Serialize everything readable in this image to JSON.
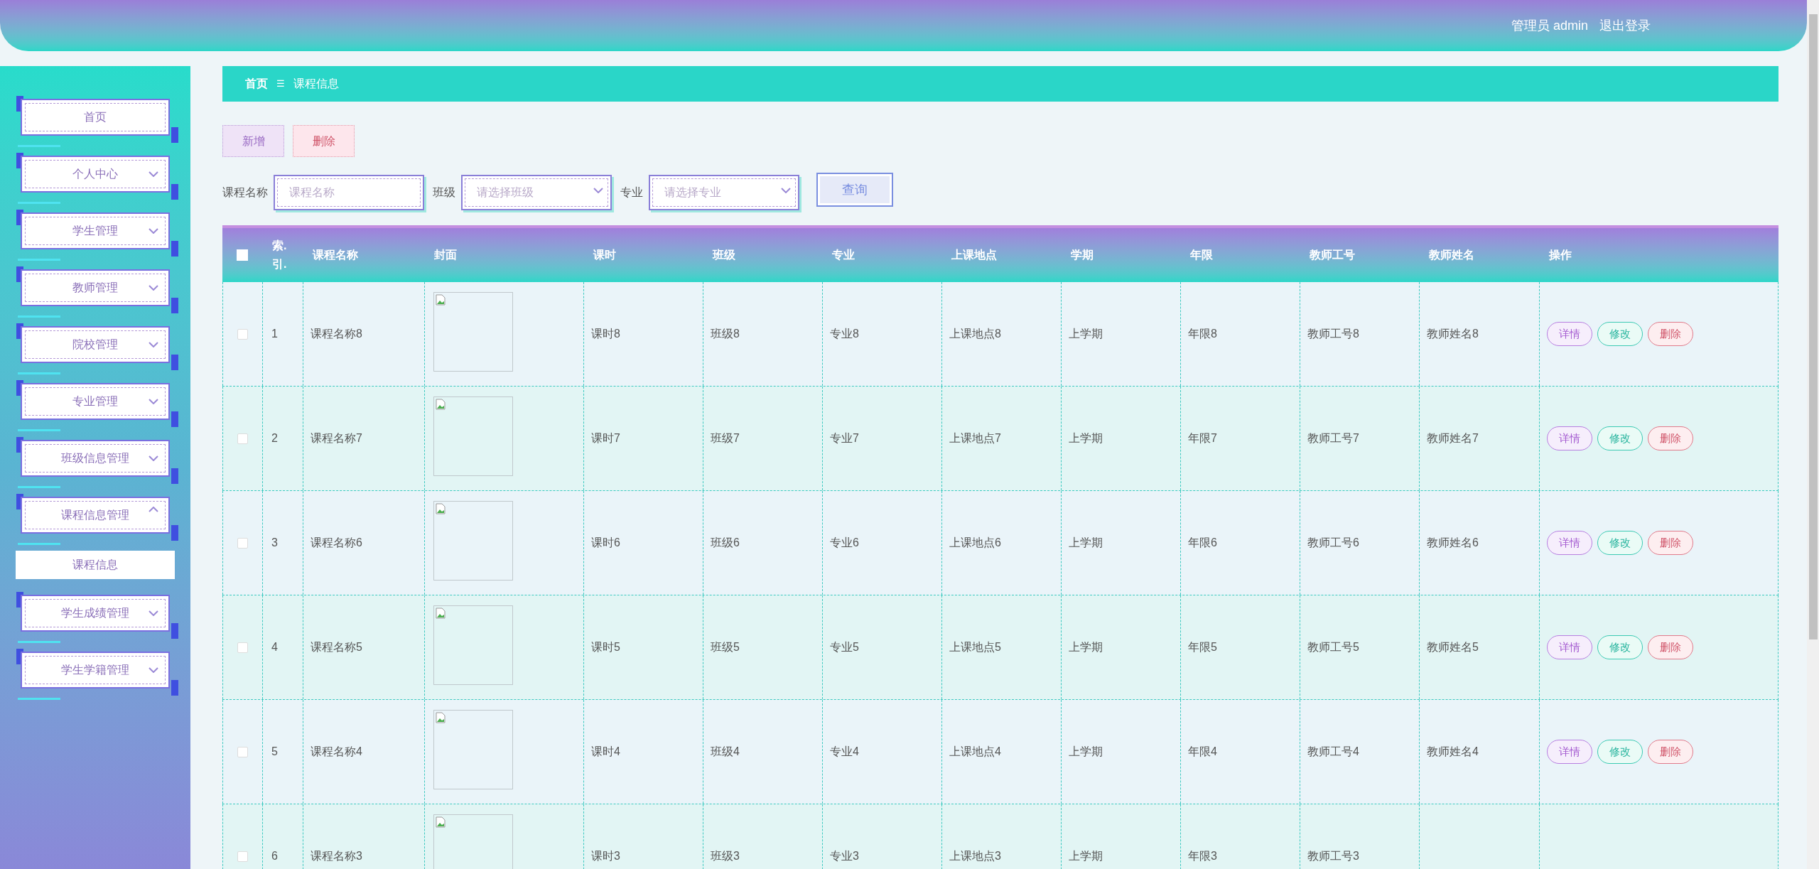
{
  "header": {
    "user": "管理员 admin",
    "logout": "退出登录"
  },
  "sidebar": {
    "items": [
      {
        "label": "首页",
        "kind": "link"
      },
      {
        "label": "个人中心",
        "kind": "group",
        "expanded": false
      },
      {
        "label": "学生管理",
        "kind": "group",
        "expanded": false
      },
      {
        "label": "教师管理",
        "kind": "group",
        "expanded": false
      },
      {
        "label": "院校管理",
        "kind": "group",
        "expanded": false
      },
      {
        "label": "专业管理",
        "kind": "group",
        "expanded": false
      },
      {
        "label": "班级信息管理",
        "kind": "group",
        "expanded": false
      },
      {
        "label": "课程信息管理",
        "kind": "group",
        "expanded": true,
        "children": [
          {
            "label": "课程信息"
          }
        ]
      },
      {
        "label": "学生成绩管理",
        "kind": "group",
        "expanded": false
      },
      {
        "label": "学生学籍管理",
        "kind": "group",
        "expanded": false
      }
    ]
  },
  "breadcrumb": {
    "home": "首页",
    "separator": "☰",
    "current": "课程信息"
  },
  "toolbar": {
    "buttons": [
      {
        "label": "新增",
        "kind": "add"
      },
      {
        "label": "删除",
        "kind": "delete"
      }
    ]
  },
  "filters": [
    {
      "label": "课程名称",
      "kind": "input",
      "placeholder": "课程名称"
    },
    {
      "label": "班级",
      "kind": "select",
      "placeholder": "请选择班级"
    },
    {
      "label": "专业",
      "kind": "select",
      "placeholder": "请选择专业"
    }
  ],
  "search_button": "查询",
  "table": {
    "columns": [
      "索.引.",
      "课程名称",
      "封面",
      "课时",
      "班级",
      "专业",
      "上课地点",
      "学期",
      "年限",
      "教师工号",
      "教师姓名",
      "操作"
    ],
    "select_all_checked": false,
    "rows": [
      {
        "checked": false,
        "cells": [
          "1",
          "课程名称8",
          "",
          "课时8",
          "班级8",
          "专业8",
          "上课地点8",
          "上学期",
          "年限8",
          "教师工号8",
          "教师姓名8"
        ],
        "actions": [
          {
            "label": "详情",
            "kind": "detail"
          },
          {
            "label": "修改",
            "kind": "edit"
          },
          {
            "label": "删除",
            "kind": "delete"
          }
        ]
      },
      {
        "checked": false,
        "cells": [
          "2",
          "课程名称7",
          "",
          "课时7",
          "班级7",
          "专业7",
          "上课地点7",
          "上学期",
          "年限7",
          "教师工号7",
          "教师姓名7"
        ],
        "actions": [
          {
            "label": "详情",
            "kind": "detail"
          },
          {
            "label": "修改",
            "kind": "edit"
          },
          {
            "label": "删除",
            "kind": "delete"
          }
        ]
      },
      {
        "checked": false,
        "cells": [
          "3",
          "课程名称6",
          "",
          "课时6",
          "班级6",
          "专业6",
          "上课地点6",
          "上学期",
          "年限6",
          "教师工号6",
          "教师姓名6"
        ],
        "actions": [
          {
            "label": "详情",
            "kind": "detail"
          },
          {
            "label": "修改",
            "kind": "edit"
          },
          {
            "label": "删除",
            "kind": "delete"
          }
        ]
      },
      {
        "checked": false,
        "cells": [
          "4",
          "课程名称5",
          "",
          "课时5",
          "班级5",
          "专业5",
          "上课地点5",
          "上学期",
          "年限5",
          "教师工号5",
          "教师姓名5"
        ],
        "actions": [
          {
            "label": "详情",
            "kind": "detail"
          },
          {
            "label": "修改",
            "kind": "edit"
          },
          {
            "label": "删除",
            "kind": "delete"
          }
        ]
      },
      {
        "checked": false,
        "cells": [
          "5",
          "课程名称4",
          "",
          "课时4",
          "班级4",
          "专业4",
          "上课地点4",
          "上学期",
          "年限4",
          "教师工号4",
          "教师姓名4"
        ],
        "actions": [
          {
            "label": "详情",
            "kind": "detail"
          },
          {
            "label": "修改",
            "kind": "edit"
          },
          {
            "label": "删除",
            "kind": "delete"
          }
        ]
      },
      {
        "checked": false,
        "cells": [
          "6",
          "课程名称3",
          "",
          "课时3",
          "班级3",
          "专业3",
          "上课地点3",
          "上学期",
          "年限3",
          "教师工号3"
        ],
        "actions": []
      }
    ]
  }
}
